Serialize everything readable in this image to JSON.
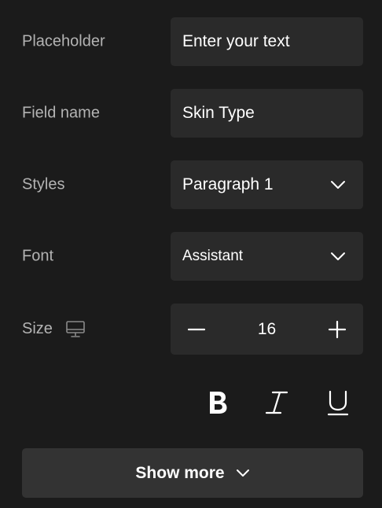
{
  "form": {
    "placeholder": {
      "label": "Placeholder",
      "value": "Enter your text"
    },
    "field_name": {
      "label": "Field name",
      "value": "Skin Type"
    },
    "styles": {
      "label": "Styles",
      "value": "Paragraph 1"
    },
    "font": {
      "label": "Font",
      "value": "Assistant"
    },
    "size": {
      "label": "Size",
      "value": "16",
      "device_icon": "desktop-monitor-icon"
    },
    "formatting": {
      "bold_icon": "bold-icon",
      "italic_icon": "italic-icon",
      "underline_icon": "underline-icon"
    }
  },
  "footer": {
    "show_more_label": "Show more"
  },
  "colors": {
    "background": "#1b1b1b",
    "control_background": "#2a2a2a",
    "button_background": "#333333",
    "label_text": "#b3b3b3",
    "value_text": "#ffffff"
  }
}
